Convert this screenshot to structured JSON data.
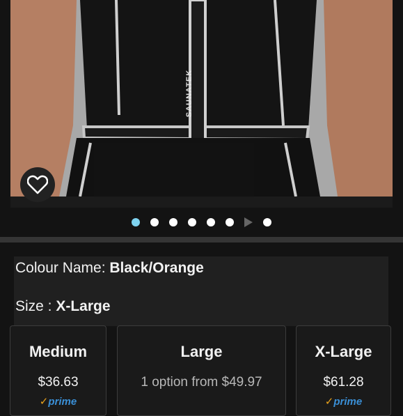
{
  "product_image": {
    "brand_text": "SAUNATEK"
  },
  "favorite": {
    "icon": "heart-icon"
  },
  "carousel": {
    "dot_count": 7,
    "active_index": 0,
    "play_icon": "play-icon"
  },
  "info": {
    "colour_label": "Colour Name: ",
    "colour_value": "Black/Orange",
    "size_label": "Size : ",
    "size_value": "X-Large"
  },
  "sizes": [
    {
      "name": "Medium",
      "price": "$36.63",
      "prime": "prime"
    },
    {
      "name": "Large",
      "price": "1 option from $49.97",
      "prime": ""
    },
    {
      "name": "X-Large",
      "price": "$61.28",
      "prime": "prime"
    }
  ],
  "colors": {
    "active_dot": "#7fd3f0",
    "prime_blue": "#3a8fd6",
    "prime_check": "#e8a21c"
  }
}
